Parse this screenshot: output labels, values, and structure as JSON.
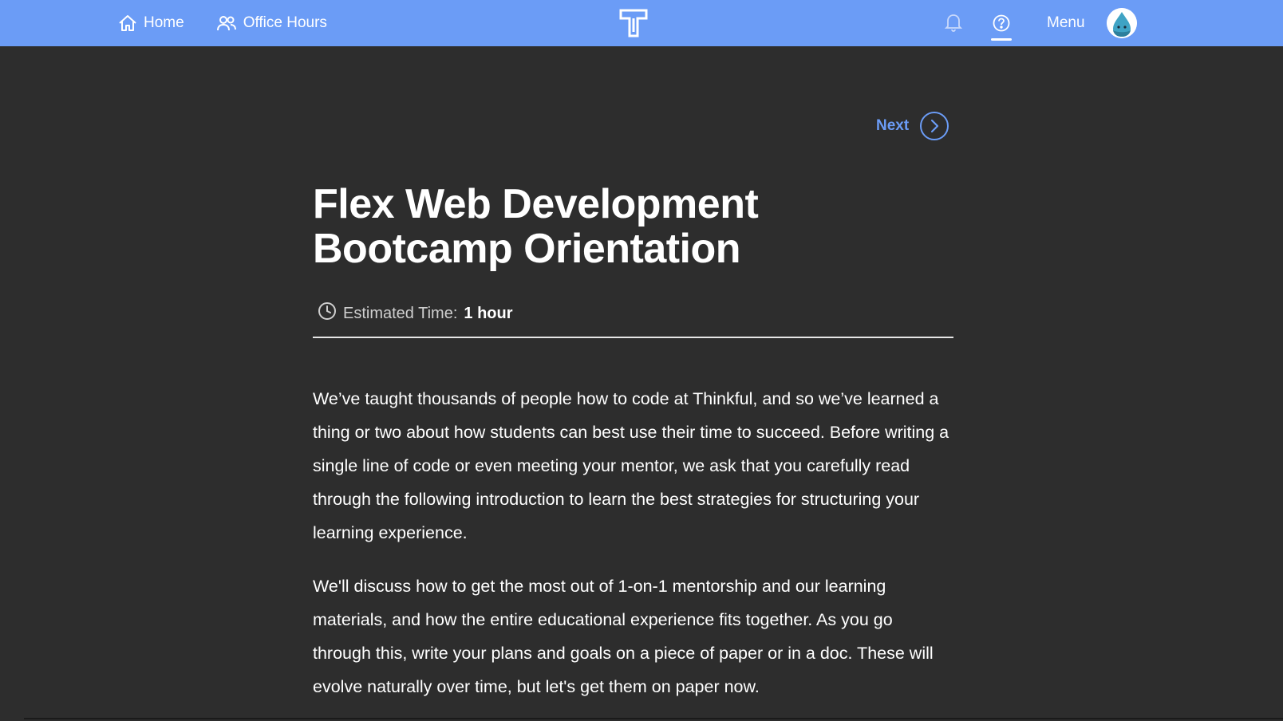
{
  "nav": {
    "home_label": "Home",
    "office_hours_label": "Office Hours",
    "menu_label": "Menu",
    "icons": {
      "home": "home-icon",
      "office_hours": "people-icon",
      "logo": "thinkful-logo",
      "bell": "bell-icon",
      "help": "help-icon",
      "avatar": "user-avatar"
    }
  },
  "pager": {
    "next_label": "Next",
    "icon": "chevron-right-circle-icon"
  },
  "lesson": {
    "title_line1": "Flex Web Development",
    "title_line2": "Bootcamp Orientation",
    "estimated_label": "Estimated Time:",
    "estimated_value": "1 hour",
    "paragraphs": [
      "We’ve taught thousands of people how to code at Thinkful, and so we’ve learned a thing or two about how students can best use their time to succeed. Before writing a single line of code or even meeting your mentor, we ask that you carefully read through the following introduction to learn the best strategies for structuring your learning experience.",
      "We'll discuss how to get the most out of 1-on-1 mentorship and our learning materials, and how the entire educational experience fits together. As you go through this, write your plans and goals on a piece of paper or in a doc. These will evolve naturally over time, but let's get them on paper now."
    ]
  },
  "colors": {
    "topbar": "#6b9cf6",
    "background": "#2d2d2d",
    "accent": "#6b9cf6",
    "text": "#ffffff"
  }
}
